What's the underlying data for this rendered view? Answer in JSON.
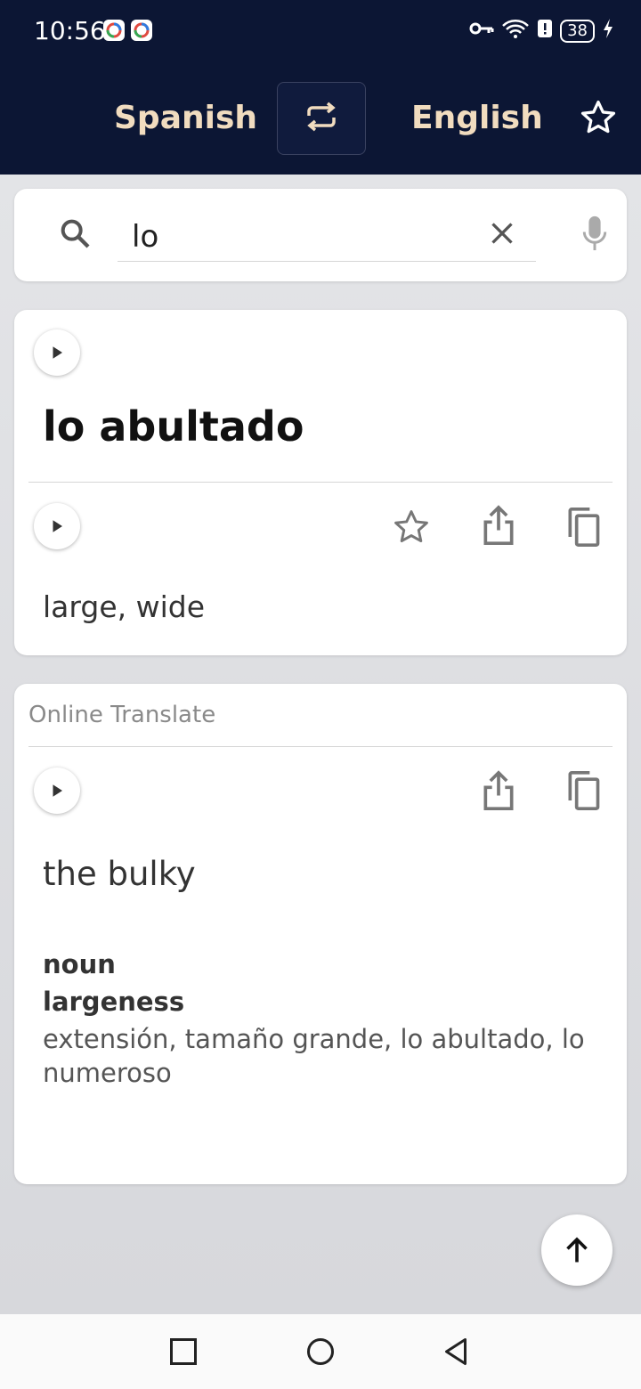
{
  "status": {
    "time": "10:56",
    "battery": "38"
  },
  "header": {
    "source_language": "Spanish",
    "target_language": "English",
    "icons": {
      "swap": "swap-icon",
      "favorite": "star-icon"
    }
  },
  "search": {
    "value": "lo",
    "icons": {
      "search": "search-icon",
      "clear": "close-icon",
      "mic": "microphone-icon"
    }
  },
  "result": {
    "term": "lo abultado",
    "translation": "large, wide",
    "icons": [
      "play-icon",
      "star-icon",
      "share-icon",
      "copy-icon"
    ]
  },
  "online": {
    "label": "Online Translate",
    "translation": "the bulky",
    "part_of_speech": "noun",
    "word": "largeness",
    "synonyms": "extensión, tamaño grande, lo abultado, lo numeroso",
    "icons": [
      "play-icon",
      "share-icon",
      "copy-icon"
    ]
  },
  "fab": {
    "icon": "arrow-up-icon"
  },
  "navbar": {
    "icons": [
      "recent-apps-icon",
      "home-icon",
      "back-icon"
    ]
  },
  "colors": {
    "header_bg": "#0c1634",
    "language_text": "#f1dcbf",
    "card_bg": "#ffffff",
    "page_bg": "#dcdde0"
  }
}
